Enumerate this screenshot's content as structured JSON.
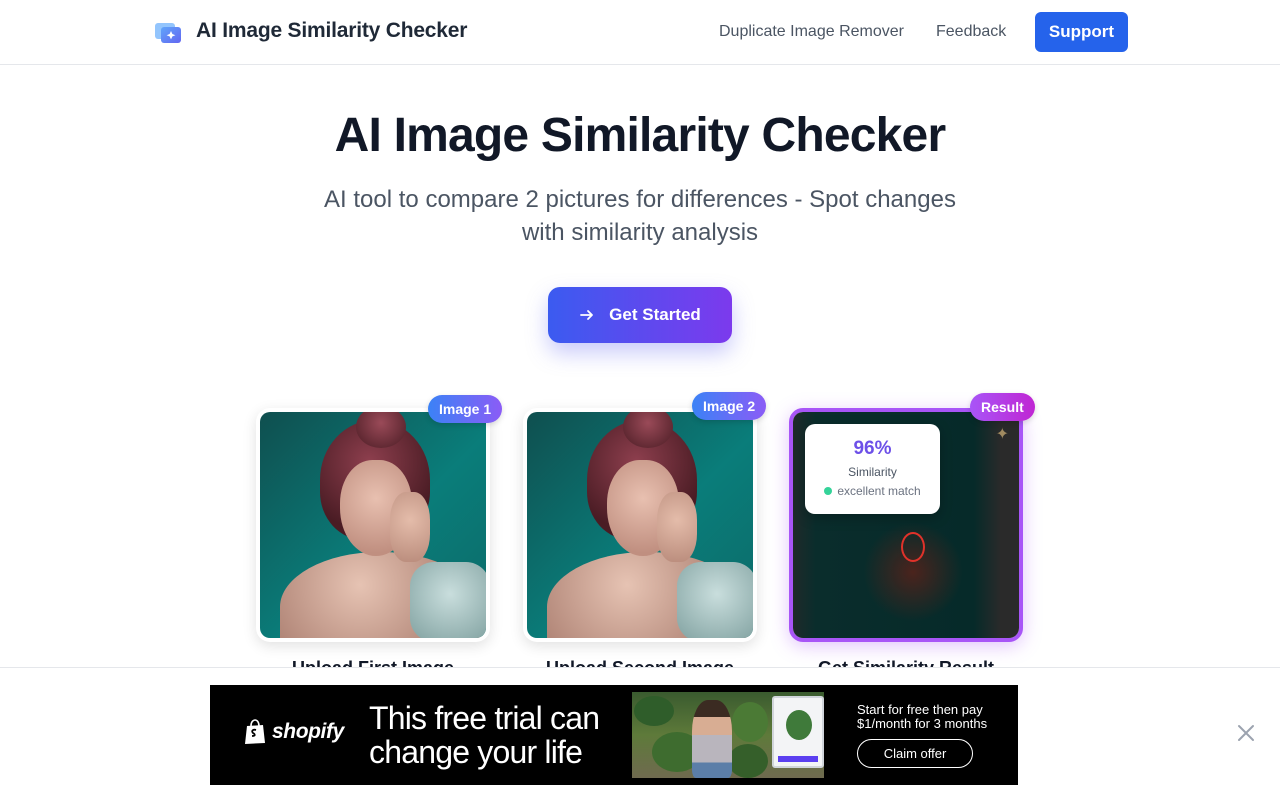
{
  "header": {
    "brand": "AI Image Similarity Checker",
    "nav": [
      "Duplicate Image Remover",
      "Feedback"
    ],
    "support_label": "Support"
  },
  "hero": {
    "title": "AI Image Similarity Checker",
    "subtitle_line1": "AI tool to compare 2 pictures for differences - Spot changes",
    "subtitle_line2": "with similarity analysis",
    "cta_label": "Get Started"
  },
  "cards": [
    {
      "badge": "Image 1",
      "caption": "Upload First Image"
    },
    {
      "badge": "Image 2",
      "caption": "Upload Second Image"
    },
    {
      "badge": "Result",
      "caption": "Get Similarity Result"
    }
  ],
  "result_popup": {
    "percent": "96%",
    "label": "Similarity",
    "status": "excellent match"
  },
  "ad": {
    "brand": "shopify",
    "headline_line1": "This free trial can",
    "headline_line2": "change your life",
    "offer_line1": "Start for free then pay",
    "offer_line2": "$1/month for 3 months",
    "claim_label": "Claim offer"
  },
  "colors": {
    "accent": "#2563eb",
    "cta_gradient": [
      "#3b5bf0",
      "#7c3aed"
    ],
    "result_border": "#a855f7",
    "similarity_text": "#6d50e8",
    "match_dot": "#34d399"
  }
}
